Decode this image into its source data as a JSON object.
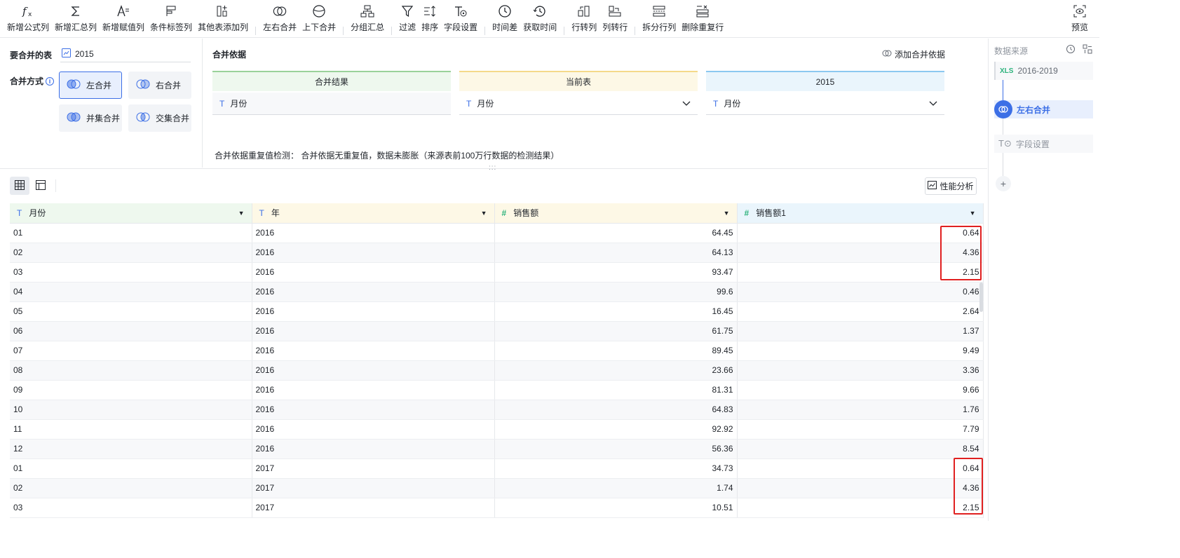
{
  "toolbar": {
    "items": [
      {
        "label": "新增公式列",
        "icon": "formula-icon"
      },
      {
        "label": "新增汇总列",
        "icon": "sigma-icon"
      },
      {
        "label": "新增赋值列",
        "icon": "assign-icon"
      },
      {
        "label": "条件标签列",
        "icon": "flag-icon"
      },
      {
        "label": "其他表添加列",
        "icon": "add-column-icon"
      },
      {
        "label": "左右合并",
        "icon": "join-icon"
      },
      {
        "label": "上下合并",
        "icon": "union-icon"
      },
      {
        "label": "分组汇总",
        "icon": "group-icon"
      },
      {
        "label": "过滤",
        "icon": "filter-icon"
      },
      {
        "label": "排序",
        "icon": "sort-icon"
      },
      {
        "label": "字段设置",
        "icon": "field-settings-icon"
      },
      {
        "label": "时间差",
        "icon": "clock-icon"
      },
      {
        "label": "获取时间",
        "icon": "clock-refresh-icon"
      },
      {
        "label": "行转列",
        "icon": "row-to-col-icon"
      },
      {
        "label": "列转行",
        "icon": "col-to-row-icon"
      },
      {
        "label": "拆分行列",
        "icon": "split-icon"
      },
      {
        "label": "删除重复行",
        "icon": "dedupe-icon"
      }
    ],
    "preview_label": "预览"
  },
  "config": {
    "merge_table_label": "要合并的表",
    "merge_table_value": "2015",
    "merge_mode_label": "合并方式",
    "modes": {
      "left": "左合并",
      "right": "右合并",
      "union": "并集合并",
      "intersect": "交集合并"
    },
    "active_mode": "左合并",
    "basis_title": "合并依据",
    "add_basis_label": "添加合并依据",
    "columns": [
      {
        "header": "合并结果",
        "field": "月份",
        "color": "#9ad29a",
        "bg": "#eef8ee"
      },
      {
        "header": "当前表",
        "field": "月份",
        "color": "#f5d98a",
        "bg": "#fdf8e6"
      },
      {
        "header": "2015",
        "field": "月份",
        "color": "#8cc8f0",
        "bg": "#eaf5fc"
      }
    ],
    "detect_text": "合并依据重复值检测：  合并依据无重复值，数据未膨胀（来源表前100万行数据的检测结果）"
  },
  "table": {
    "perf_label": "性能分析",
    "headers": [
      {
        "label": "月份",
        "type": "text",
        "bg": "#eef8ee"
      },
      {
        "label": "年",
        "type": "text",
        "bg": "#fdf8e6"
      },
      {
        "label": "销售额",
        "type": "number",
        "bg": "#fdf8e6"
      },
      {
        "label": "销售额1",
        "type": "number",
        "bg": "#eaf5fc"
      }
    ],
    "rows": [
      [
        "01",
        "2016",
        "64.45",
        "0.64"
      ],
      [
        "02",
        "2016",
        "64.13",
        "4.36"
      ],
      [
        "03",
        "2016",
        "93.47",
        "2.15"
      ],
      [
        "04",
        "2016",
        "99.6",
        "0.46"
      ],
      [
        "05",
        "2016",
        "16.45",
        "2.64"
      ],
      [
        "06",
        "2016",
        "61.75",
        "1.37"
      ],
      [
        "07",
        "2016",
        "89.45",
        "9.49"
      ],
      [
        "08",
        "2016",
        "23.66",
        "3.36"
      ],
      [
        "09",
        "2016",
        "81.31",
        "9.66"
      ],
      [
        "10",
        "2016",
        "64.83",
        "1.76"
      ],
      [
        "11",
        "2016",
        "92.92",
        "7.79"
      ],
      [
        "12",
        "2016",
        "56.36",
        "8.54"
      ],
      [
        "01",
        "2017",
        "34.73",
        "0.64"
      ],
      [
        "02",
        "2017",
        "1.74",
        "4.36"
      ],
      [
        "03",
        "2017",
        "10.51",
        "2.15"
      ]
    ]
  },
  "right_panel": {
    "title": "数据来源",
    "source": "2016-2019",
    "source_icon": "XLS",
    "step_join": "左右合并",
    "step_field": "字段设置",
    "add_label": "+"
  }
}
